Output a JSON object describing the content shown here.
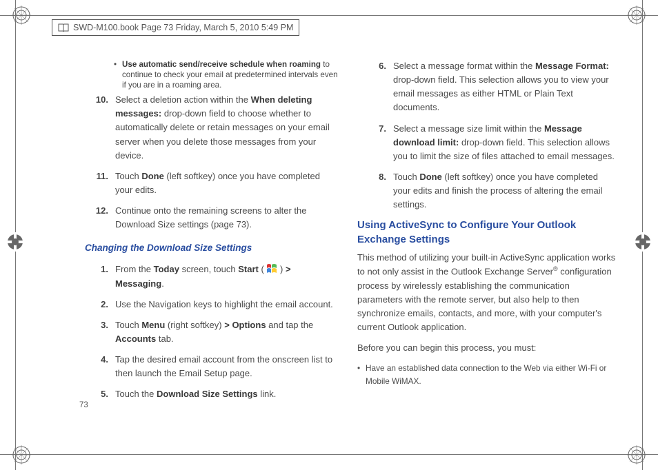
{
  "meta": {
    "header_text": "SWD-M100.book  Page 73  Friday, March 5, 2010  5:49 PM",
    "page_number": "73"
  },
  "left": {
    "bullet": {
      "bold": "Use automatic send/receive schedule when roaming",
      "rest": " to continue to check your email at predetermined intervals even if you are in a roaming area."
    },
    "step10": {
      "num": "10.",
      "pre": "Select a deletion action within the ",
      "b1": "When deleting messages:",
      "rest": " drop-down field to choose whether to automatically delete or retain messages on your email server when you delete those messages from your device."
    },
    "step11": {
      "num": "11.",
      "pre": "Touch ",
      "b1": "Done",
      "rest": " (left softkey) once you have completed your edits."
    },
    "step12": {
      "num": "12.",
      "text": "Continue onto the remaining screens to alter the Download Size settings (page 73)."
    },
    "subhead": "Changing the Download Size Settings",
    "s1": {
      "num": "1.",
      "a": "From the ",
      "b1": "Today",
      "b": " screen, touch ",
      "b2": "Start",
      "c": " ( ",
      "d": " ) ",
      "b3": "> Messaging",
      "e": "."
    },
    "s2": {
      "num": "2.",
      "text": "Use the Navigation keys to highlight the email account."
    },
    "s3": {
      "num": "3.",
      "a": "Touch ",
      "b1": "Menu",
      "b": " (right softkey) ",
      "b2": "> Options",
      "c": " and tap the ",
      "b3": "Accounts",
      "d": " tab."
    },
    "s4": {
      "num": "4.",
      "text": "Tap the desired email account from the onscreen list to then launch the Email Setup page."
    },
    "s5": {
      "num": "5.",
      "a": "Touch the ",
      "b1": "Download Size Settings",
      "b": " link."
    }
  },
  "right": {
    "s6": {
      "num": "6.",
      "a": "Select a message format within the ",
      "b1": "Message Format:",
      "b": " drop-down field. This selection allows you to view your email messages as either HTML or Plain Text documents."
    },
    "s7": {
      "num": "7.",
      "a": "Select a message size limit within the ",
      "b1": "Message download limit:",
      "b": " drop-down field. This selection allows you to limit the size of files attached to email messages."
    },
    "s8": {
      "num": "8.",
      "a": "Touch ",
      "b1": "Done",
      "b": " (left softkey) once you have completed your edits and finish the process of altering the email settings."
    },
    "sec_head": "Using ActiveSync to Configure Your Outlook Exchange Settings",
    "p1a": "This method of utilizing your built-in ActiveSync application works to not only assist in the Outlook Exchange Server",
    "p1sup": "®",
    "p1b": " configuration process by wirelessly establishing the communication parameters with the remote server, but also help to then synchronize emails, contacts, and more, with your computer's current Outlook application.",
    "p2": "Before you can begin this process, you must:",
    "b1": "Have an established data connection to the Web via either Wi-Fi or Mobile WiMAX."
  }
}
